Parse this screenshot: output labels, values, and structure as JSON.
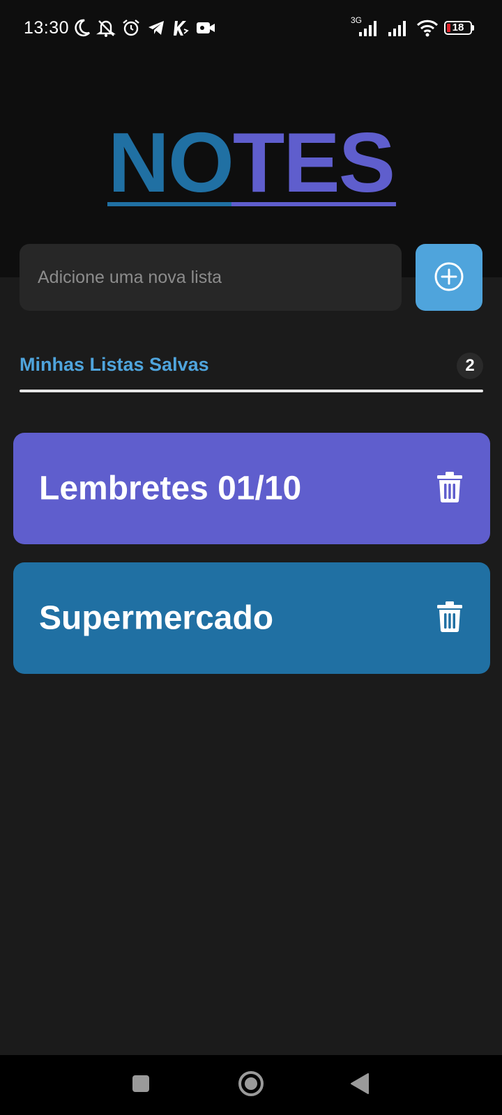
{
  "status_bar": {
    "time": "13:30",
    "left_icons": [
      "moon-icon",
      "bell-off-icon",
      "alarm-icon",
      "telegram-icon",
      "app-k-icon",
      "video-camera-icon"
    ],
    "network_type": "3G",
    "battery_level": "18",
    "battery_color": "#e0232b"
  },
  "app": {
    "title_part_1": "NO",
    "title_part_2": "TES",
    "colors": {
      "primary_blue": "#2070a3",
      "primary_purple": "#5f5ecd",
      "accent": "#4fa4dc"
    }
  },
  "new_list": {
    "placeholder": "Adicione uma nova lista",
    "value": "",
    "add_icon": "plus-circle-icon"
  },
  "saved_lists": {
    "heading": "Minhas Listas Salvas",
    "count": "2",
    "items": [
      {
        "title": "Lembretes 01/10",
        "color": "#5f5ecd",
        "delete_icon": "trash-icon"
      },
      {
        "title": "Supermercado",
        "color": "#2070a3",
        "delete_icon": "trash-icon"
      }
    ]
  },
  "nav_bar": {
    "buttons": [
      "recents-square-icon",
      "home-circle-icon",
      "back-triangle-icon"
    ]
  }
}
